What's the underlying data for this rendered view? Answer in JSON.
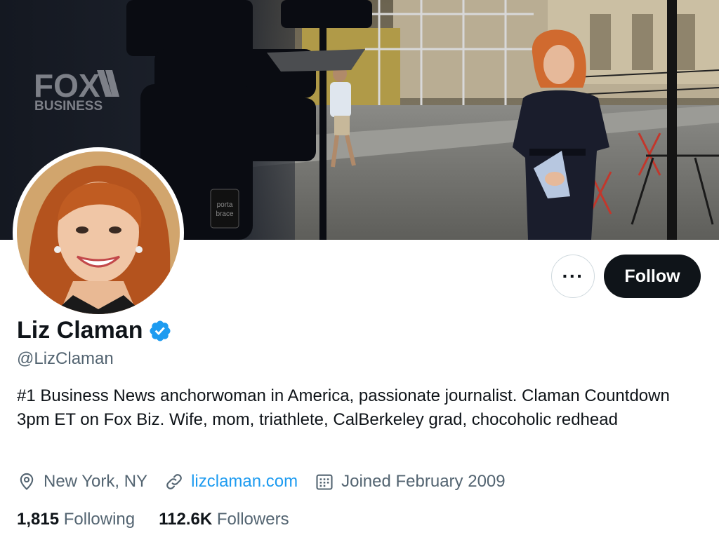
{
  "banner": {
    "logo_line1": "FOX",
    "logo_line2": "BUSINESS"
  },
  "profile": {
    "display_name": "Liz Claman",
    "handle": "@LizClaman",
    "bio": "#1 Business News anchorwoman in America, passionate journalist. Claman Countdown 3pm ET on Fox Biz. Wife, mom, triathlete, CalBerkeley grad, chocoholic redhead",
    "location": "New York, NY",
    "website": "lizclaman.com",
    "joined": "Joined February 2009"
  },
  "actions": {
    "more_label": "···",
    "follow_label": "Follow"
  },
  "stats": {
    "following_count": "1,815",
    "following_label": "Following",
    "followers_count": "112.6K",
    "followers_label": "Followers"
  },
  "colors": {
    "accent": "#1d9bf0",
    "text_primary": "#0f1419",
    "text_secondary": "#536471"
  },
  "icons": [
    "verified-badge-icon",
    "location-pin-icon",
    "link-icon",
    "calendar-icon"
  ]
}
